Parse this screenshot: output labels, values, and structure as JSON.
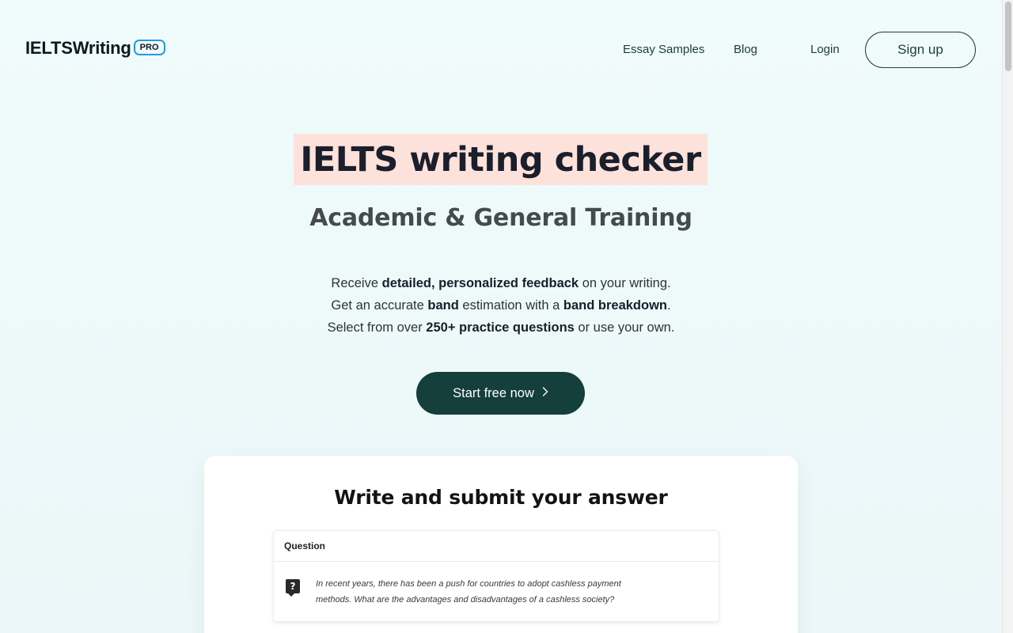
{
  "header": {
    "logo_text": "IELTSWriting",
    "logo_badge": "PRO",
    "nav": {
      "essay_samples": "Essay Samples",
      "blog": "Blog",
      "login": "Login",
      "signup": "Sign up"
    }
  },
  "hero": {
    "title": "IELTS writing checker",
    "subtitle": "Academic & General Training",
    "line1": {
      "pre": "Receive ",
      "b1": "detailed, personalized feedback",
      "post": " on your writing."
    },
    "line2": {
      "pre": "Get an accurate ",
      "b1": "band",
      "mid": " estimation with a ",
      "b2": "band breakdown",
      "post": "."
    },
    "line3": {
      "pre": "Select from over ",
      "b1": "250+ practice questions",
      "post": " or use your own."
    },
    "cta_label": "Start free now",
    "cta_icon": "chevron-right-icon"
  },
  "card": {
    "title": "Write and submit your answer",
    "question_label": "Question",
    "question_icon": "question-icon",
    "question_text": "In recent years, there has been a push for countries to adopt cashless payment methods. What are the advantages and disadvantages of a cashless society?"
  },
  "colors": {
    "background": "#eef9f9",
    "accent_dark_green": "#143f3a",
    "title_highlight": "#fde2dc",
    "badge_border": "#1e9be3"
  }
}
